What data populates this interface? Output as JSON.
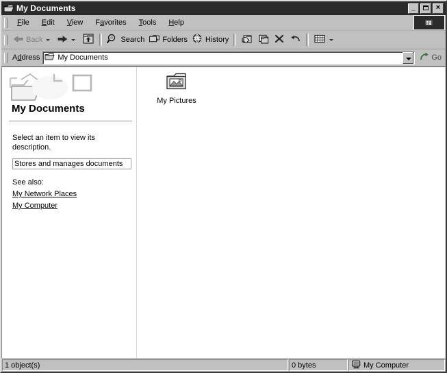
{
  "window": {
    "title": "My Documents",
    "title_icon": "folder-open-icon",
    "controls": {
      "minimize": "_",
      "maximize": "maximize-icon",
      "close": "×"
    },
    "brand_logo": "windows-logo-icon"
  },
  "menu": {
    "items": [
      {
        "label": "File",
        "accel": "F"
      },
      {
        "label": "Edit",
        "accel": "E"
      },
      {
        "label": "View",
        "accel": "V"
      },
      {
        "label": "Favorites",
        "accel": "a"
      },
      {
        "label": "Tools",
        "accel": "T"
      },
      {
        "label": "Help",
        "accel": "H"
      }
    ]
  },
  "toolbar": {
    "back_label": "Back",
    "back_icon": "arrow-left-icon",
    "forward_icon": "arrow-right-icon",
    "up_icon": "folder-up-icon",
    "search_label": "Search",
    "search_icon": "magnifier-icon",
    "folders_label": "Folders",
    "folders_icon": "folder-icon",
    "history_label": "History",
    "history_icon": "globe-clock-icon",
    "move_to_icon": "move-to-folder-icon",
    "copy_to_icon": "copy-to-folder-icon",
    "delete_icon": "delete-x-icon",
    "undo_icon": "undo-arrow-icon",
    "views_icon": "views-grid-icon"
  },
  "address": {
    "label": "Address",
    "icon": "folder-open-icon",
    "value": "My Documents",
    "dropdown_icon": "chevron-down-icon",
    "go_label": "Go",
    "go_icon": "go-arrow-icon"
  },
  "panel": {
    "watermark_icon": "folders-watermark",
    "heading": "My Documents",
    "description": "Select an item to view its description.",
    "info_text": "Stores and manages documents",
    "see_also_label": "See also:",
    "links": [
      {
        "label": "My Network Places"
      },
      {
        "label": "My Computer"
      }
    ]
  },
  "files": {
    "items": [
      {
        "label": "My Pictures",
        "icon": "pictures-folder-icon"
      }
    ]
  },
  "status": {
    "objects": "1 object(s)",
    "size": "0 bytes",
    "zone": "My Computer",
    "zone_icon": "computer-icon"
  },
  "colors": {
    "face": "#c0c0c0",
    "titlebar": "#2b2b2b",
    "client": "#ffffff",
    "text": "#000000",
    "disabled_text": "#808080"
  }
}
